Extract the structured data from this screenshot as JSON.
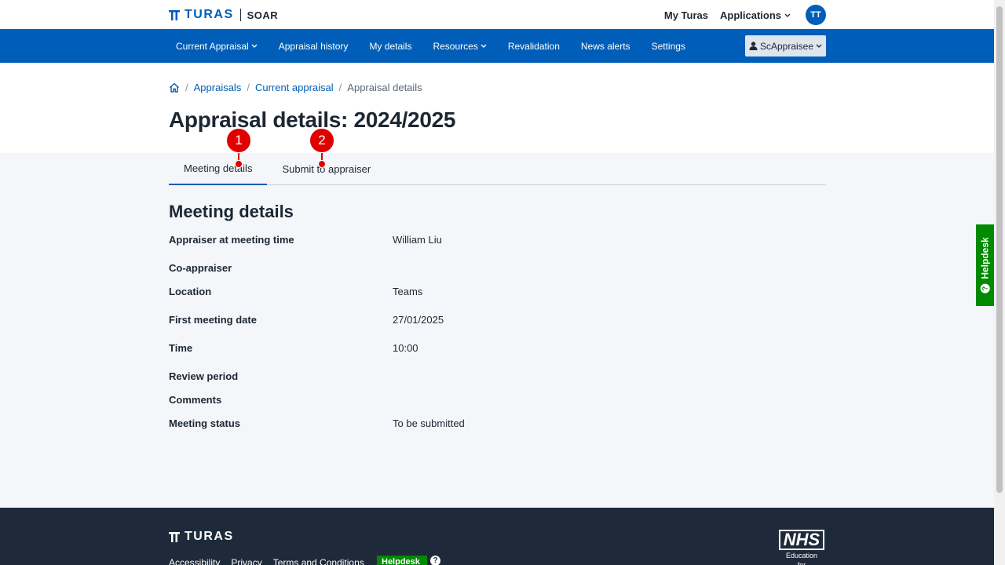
{
  "topbar": {
    "brand": "TURAS",
    "app_name": "SOAR",
    "links": [
      "My Turas",
      "Applications"
    ],
    "avatar_initials": "TT"
  },
  "nav": {
    "items": [
      {
        "label": "Current Appraisal",
        "dropdown": true
      },
      {
        "label": "Appraisal history",
        "dropdown": false
      },
      {
        "label": "My details",
        "dropdown": false
      },
      {
        "label": "Resources",
        "dropdown": true
      },
      {
        "label": "Revalidation",
        "dropdown": false
      },
      {
        "label": "News alerts",
        "dropdown": false
      },
      {
        "label": "Settings",
        "dropdown": false
      }
    ],
    "role_button": "ScAppraisee"
  },
  "breadcrumb": {
    "items": [
      "Appraisals",
      "Current appraisal"
    ],
    "current": "Appraisal details"
  },
  "page_title": "Appraisal details: 2024/2025",
  "tabs": [
    {
      "label": "Meeting details",
      "active": true
    },
    {
      "label": "Submit to appraiser",
      "active": false
    }
  ],
  "section_title": "Meeting details",
  "details": [
    {
      "label": "Appraiser at meeting time",
      "value": "William Liu"
    },
    {
      "label": "Co-appraiser",
      "value": ""
    },
    {
      "label": "Location",
      "value": "Teams"
    },
    {
      "label": "First meeting date",
      "value": "27/01/2025"
    },
    {
      "label": "Time",
      "value": "10:00"
    },
    {
      "label": "Review period",
      "value": ""
    },
    {
      "label": "Comments",
      "value": ""
    },
    {
      "label": "Meeting status",
      "value": "To be submitted"
    }
  ],
  "footer": {
    "brand": "TURAS",
    "links": [
      "Accessibility",
      "Privacy",
      "Terms and Conditions"
    ],
    "helpdesk": "Helpdesk",
    "nhs_mark": "NHS",
    "nhs_sub": [
      "Education",
      "for"
    ]
  },
  "helpdesk_tab": "Helpdesk",
  "markers": [
    "1",
    "2"
  ],
  "colors": {
    "primary": "#005eb8",
    "footer_bg": "#1e2a3a",
    "helpdesk_green": "#008a00",
    "content_bg": "#f4f6fa",
    "marker_red": "#e00000"
  },
  "icons": {
    "home": "home-icon",
    "chevron": "chevron-down-icon",
    "person": "person-icon",
    "question": "question-icon",
    "turas_logo": "turas-logo-icon"
  }
}
